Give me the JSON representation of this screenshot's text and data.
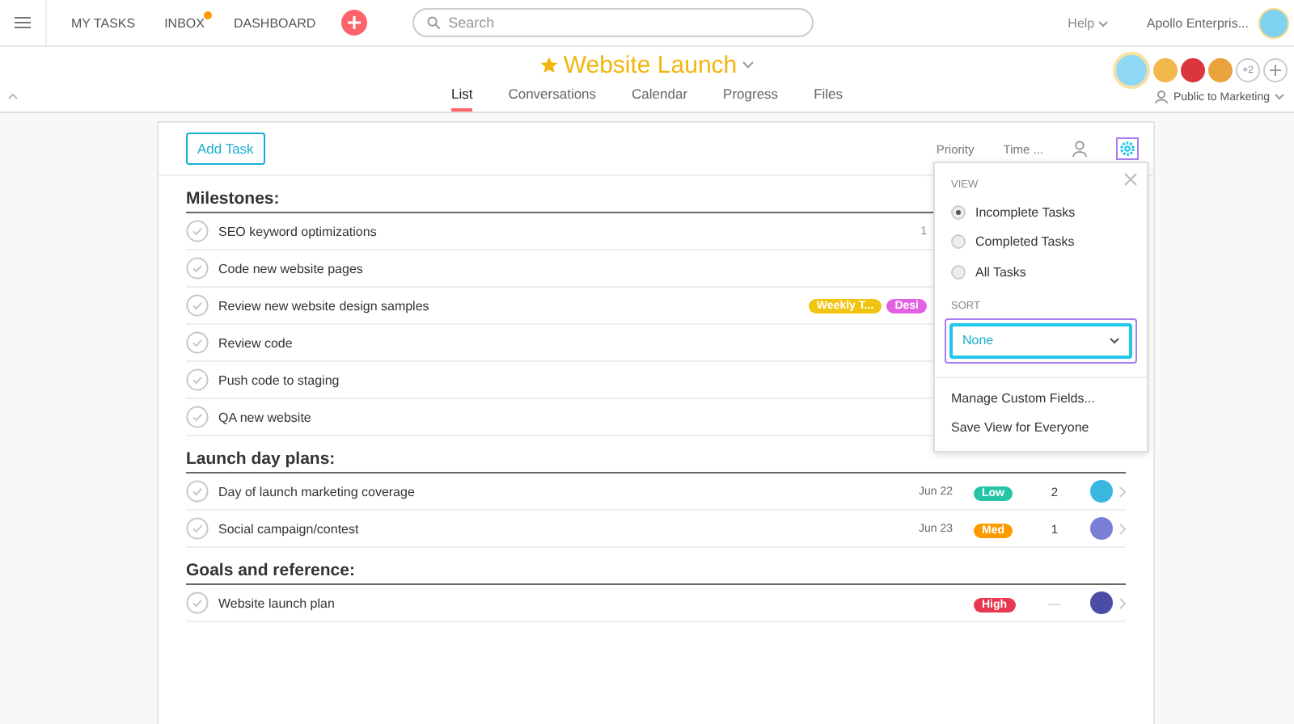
{
  "topbar": {
    "nav": [
      {
        "label": "MY TASKS",
        "dot": false
      },
      {
        "label": "INBOX",
        "dot": true
      },
      {
        "label": "DASHBOARD",
        "dot": false
      }
    ],
    "search": {
      "placeholder": "Search"
    },
    "help": "Help",
    "org": "Apollo Enterpris..."
  },
  "project": {
    "title": "Website Launch",
    "starred": true,
    "tabs": [
      {
        "label": "List",
        "selected": true
      },
      {
        "label": "Conversations",
        "selected": false
      },
      {
        "label": "Calendar",
        "selected": false
      },
      {
        "label": "Progress",
        "selected": false
      },
      {
        "label": "Files",
        "selected": false
      }
    ],
    "members": [
      {
        "color": "#f2b84b"
      },
      {
        "color": "#d9363e"
      },
      {
        "color": "#e8a33c"
      }
    ],
    "more_members": "+2",
    "privacy": "Public to Marketing"
  },
  "toolbar": {
    "add_task": "Add Task",
    "columns": [
      "Priority",
      "Time ..."
    ]
  },
  "sections": [
    {
      "title": "Milestones:",
      "tasks": [
        {
          "name": "SEO keyword optimizations",
          "fragment": "1"
        },
        {
          "name": "Code new website pages"
        },
        {
          "name": "Review new website design samples",
          "tags": [
            {
              "label": "Weekly T...",
              "color": "#f1c40f"
            },
            {
              "label": "Desi",
              "color": "#e362e3"
            }
          ]
        },
        {
          "name": "Review code"
        },
        {
          "name": "Push code to staging"
        },
        {
          "name": "QA new website"
        }
      ]
    },
    {
      "title": "Launch day plans:",
      "tasks": [
        {
          "name": "Day of launch marketing coverage",
          "date": "Jun 22",
          "priority": {
            "label": "Low",
            "color": "#25c4a4"
          },
          "time": "2",
          "assignee": {
            "color": "#3ab7e0"
          }
        },
        {
          "name": "Social campaign/contest",
          "date": "Jun 23",
          "priority": {
            "label": "Med",
            "color": "#fd9a00"
          },
          "time": "1",
          "assignee": {
            "color": "#7a7fd6"
          }
        }
      ]
    },
    {
      "title": "Goals and reference:",
      "tasks": [
        {
          "name": "Website launch plan",
          "priority": {
            "label": "High",
            "color": "#e8384f"
          },
          "time": "—",
          "assignee": {
            "color": "#4b4ca8"
          }
        }
      ]
    }
  ],
  "menu": {
    "view_label": "VIEW",
    "options": [
      {
        "label": "Incomplete Tasks",
        "selected": true
      },
      {
        "label": "Completed Tasks",
        "selected": false
      },
      {
        "label": "All Tasks",
        "selected": false
      }
    ],
    "sort_label": "SORT",
    "sort_value": "None",
    "actions": [
      "Manage Custom Fields...",
      "Save View for Everyone"
    ]
  }
}
